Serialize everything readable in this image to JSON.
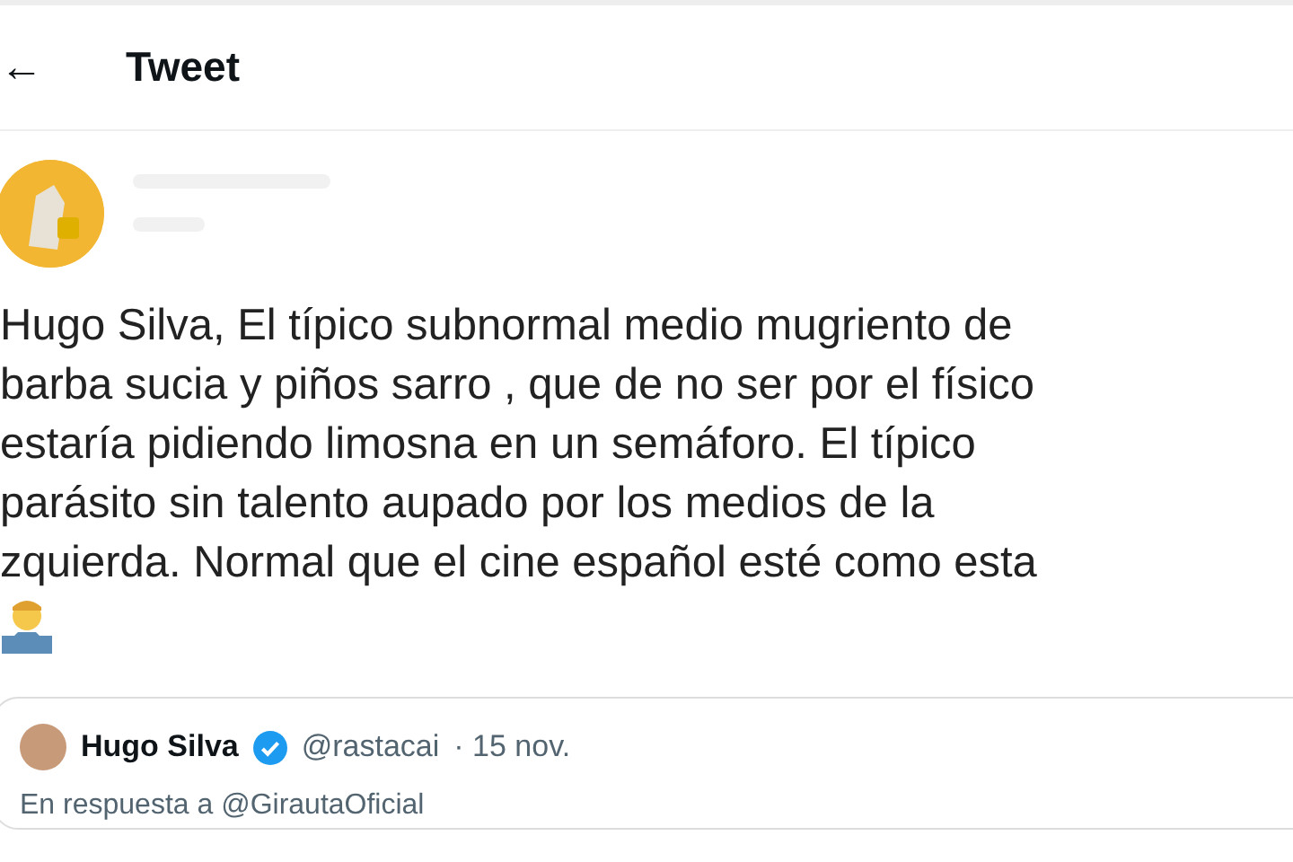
{
  "header": {
    "back": "←",
    "title": "Tweet"
  },
  "tweet": {
    "text_lines": [
      "Hugo Silva, El típico subnormal medio mugriento de",
      "barba sucia y piños sarro , que de no ser por el físico",
      "estaría pidiendo limosna en un semáforo. El típico",
      "parásito sin talento aupado por los medios de la",
      "zquierda. Normal que el cine español esté como esta"
    ]
  },
  "quoted": {
    "name": "Hugo Silva",
    "verified": true,
    "handle": "@rastacai",
    "date": "· 15 nov.",
    "reply_to": "En respuesta a @GirautaOficial"
  }
}
